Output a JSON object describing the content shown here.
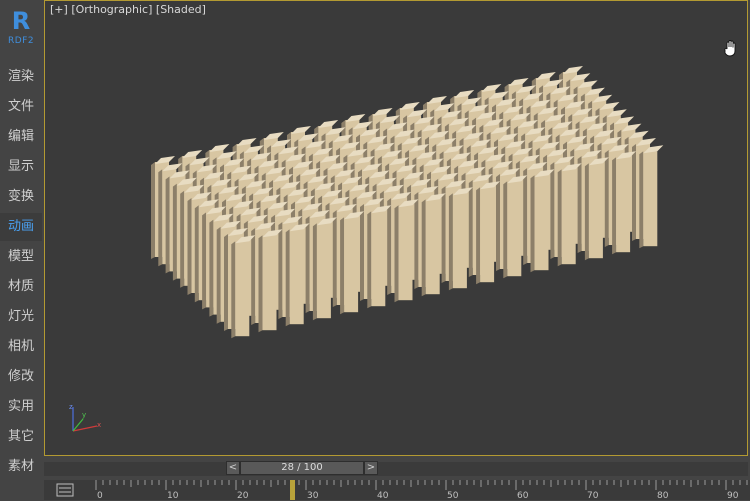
{
  "app": {
    "logo_letter": "R",
    "logo_sub": "RDF2"
  },
  "sidebar": {
    "items": [
      {
        "label": "渲染",
        "active": false
      },
      {
        "label": "文件",
        "active": false
      },
      {
        "label": "编辑",
        "active": false
      },
      {
        "label": "显示",
        "active": false
      },
      {
        "label": "变换",
        "active": false
      },
      {
        "label": "动画",
        "active": true
      },
      {
        "label": "模型",
        "active": false
      },
      {
        "label": "材质",
        "active": false
      },
      {
        "label": "灯光",
        "active": false
      },
      {
        "label": "相机",
        "active": false
      },
      {
        "label": "修改",
        "active": false
      },
      {
        "label": "实用",
        "active": false
      },
      {
        "label": "其它",
        "active": false
      },
      {
        "label": "素材",
        "active": false
      }
    ]
  },
  "viewport": {
    "plus": "[+]",
    "view": "[Orthographic]",
    "shading": "[Shaded]",
    "grid_rows": 12,
    "grid_cols": 16,
    "pillar_color": "#d8c6a2",
    "border_color": "#b39a32",
    "pan_icon": "hand-icon"
  },
  "timeline": {
    "frame_text": "28 / 100",
    "prev": "<",
    "next": ">",
    "current_frame": 28,
    "ruler_labels": [
      "0",
      "10",
      "20",
      "30",
      "40",
      "50",
      "60",
      "70",
      "80",
      "90"
    ],
    "marker_color": "#b8a23a"
  }
}
